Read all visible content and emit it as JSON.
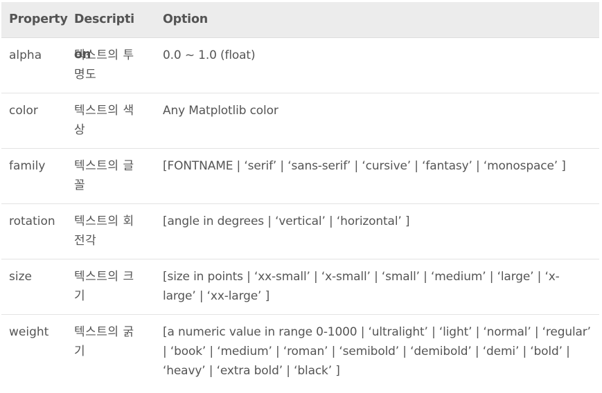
{
  "table": {
    "headers": [
      "Property",
      "Description",
      "Option"
    ],
    "rows": [
      {
        "property": "alpha",
        "description": "텍스트의 투명도",
        "option": "0.0 ~ 1.0 (float)"
      },
      {
        "property": "color",
        "description": "텍스트의 색상",
        "option": "Any Matplotlib color"
      },
      {
        "property": "family",
        "description": "텍스트의 글꼴",
        "option": "[FONTNAME | ‘serif’ | ‘sans-serif’ | ‘cursive’ | ‘fantasy’ | ‘monospace’ ]"
      },
      {
        "property": "rotation",
        "description": "텍스트의 회전각",
        "option": "[angle in degrees | ‘vertical’ | ‘horizontal’ ]"
      },
      {
        "property": "size",
        "description": "텍스트의 크기",
        "option": "[size in points | ‘xx-small’ | ‘x-small’ | ‘small’ | ‘medium’ | ‘large’ | ‘x-large’ | ‘xx-large’ ]"
      },
      {
        "property": "weight",
        "description": "텍스트의 굵기",
        "option": "[a numeric value in range 0-1000 | ‘ultralight’ | ‘light’ | ‘normal’ | ‘regular’ | ‘book’ | ‘medium’ | ‘roman’ | ‘semibold’ | ‘demibold’ | ‘demi’ | ‘bold’ | ‘heavy’ | ‘extra bold’ | ‘black’ ]"
      }
    ]
  },
  "colors": {
    "header_background": "#ececec",
    "text": "#555555",
    "row_border": "#e3e3e3"
  }
}
